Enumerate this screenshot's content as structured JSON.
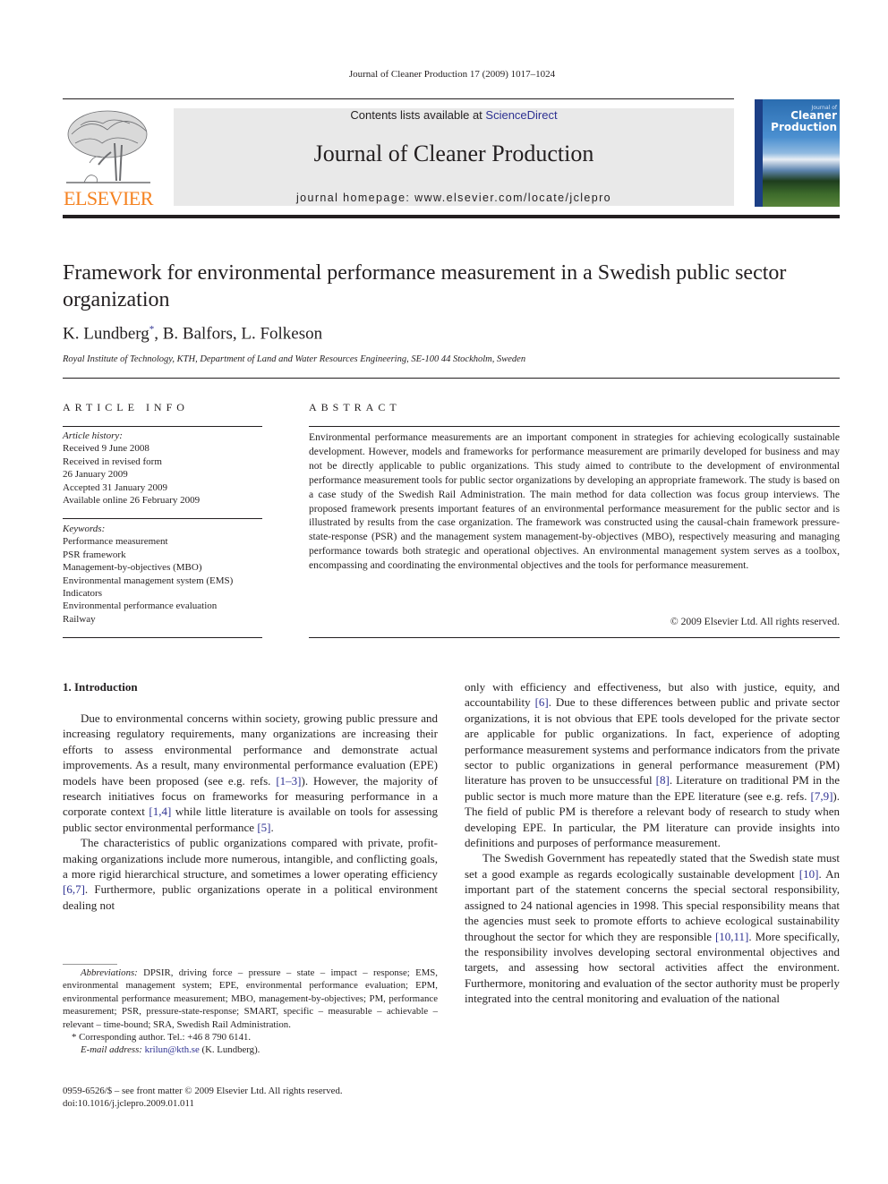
{
  "header": {
    "running_head": "Journal of Cleaner Production 17 (2009) 1017–1024",
    "contents_prefix": "Contents lists available at ",
    "contents_link": "ScienceDirect",
    "journal_title": "Journal of Cleaner Production",
    "homepage": "journal homepage: www.elsevier.com/locate/jclepro",
    "publisher_logo": "ELSEVIER",
    "cover": {
      "line1": "Journal of",
      "line2": "Cleaner",
      "line3": "Production"
    },
    "colors": {
      "publisher_orange": "#f58220",
      "link_blue": "#2e3192",
      "masthead_gray": "#e9e9e9"
    }
  },
  "article": {
    "title": "Framework for environmental performance measurement in a Swedish public sector organization",
    "authors": [
      {
        "name": "K. Lundberg",
        "mark": "*",
        "sep": ", "
      },
      {
        "name": "B. Balfors",
        "mark": "",
        "sep": ", "
      },
      {
        "name": "L. Folkeson",
        "mark": "",
        "sep": ""
      }
    ],
    "affiliation": "Royal Institute of Technology, KTH, Department of Land and Water Resources Engineering, SE-100 44 Stockholm, Sweden"
  },
  "article_info": {
    "heading": "ARTICLE INFO",
    "history_label": "Article history:",
    "history": [
      "Received 9 June 2008",
      "Received in revised form",
      "26 January 2009",
      "Accepted 31 January 2009",
      "Available online 26 February 2009"
    ],
    "keywords_label": "Keywords:",
    "keywords": [
      "Performance measurement",
      "PSR framework",
      "Management-by-objectives (MBO)",
      "Environmental management system (EMS)",
      "Indicators",
      "Environmental performance evaluation",
      "Railway"
    ]
  },
  "abstract": {
    "heading": "ABSTRACT",
    "text": "Environmental performance measurements are an important component in strategies for achieving ecologically sustainable development. However, models and frameworks for performance measurement are primarily developed for business and may not be directly applicable to public organizations. This study aimed to contribute to the development of environmental performance measurement tools for public sector organizations by developing an appropriate framework. The study is based on a case study of the Swedish Rail Administration. The main method for data collection was focus group interviews. The proposed framework presents important features of an environmental performance measurement for the public sector and is illustrated by results from the case organization. The framework was constructed using the causal-chain framework pressure-state-response (PSR) and the management system management-by-objectives (MBO), respectively measuring and managing performance towards both strategic and operational objectives. An environmental management system serves as a toolbox, encompassing and coordinating the environmental objectives and the tools for performance measurement.",
    "copyright": "© 2009 Elsevier Ltd. All rights reserved."
  },
  "introduction": {
    "heading": "1.  Introduction",
    "left_paragraphs": [
      [
        {
          "t": "Due to environmental concerns within society, growing public pressure and increasing regulatory requirements, many organizations are increasing their efforts to assess environmental performance and demonstrate actual improvements. As a result, many environmental performance evaluation (EPE) models have been proposed (see e.g. refs. "
        },
        {
          "t": "[1–3]",
          "cite": true
        },
        {
          "t": "). However, the majority of research initiatives focus on frameworks for measuring performance in a corporate context "
        },
        {
          "t": "[1,4]",
          "cite": true
        },
        {
          "t": " while little literature is available on tools for assessing public sector environmental performance "
        },
        {
          "t": "[5]",
          "cite": true
        },
        {
          "t": "."
        }
      ],
      [
        {
          "t": "The characteristics of public organizations compared with private, profit-making organizations include more numerous, intangible, and conflicting goals, a more rigid hierarchical structure, and sometimes a lower operating efficiency "
        },
        {
          "t": "[6,7]",
          "cite": true
        },
        {
          "t": ". Furthermore, public organizations operate in a political environment dealing not"
        }
      ]
    ],
    "right_paragraphs": [
      [
        {
          "t": "only with efficiency and effectiveness, but also with justice, equity, and accountability "
        },
        {
          "t": "[6]",
          "cite": true
        },
        {
          "t": ". Due to these differences between public and private sector organizations, it is not obvious that EPE tools developed for the private sector are applicable for public organizations. In fact, experience of adopting performance measurement systems and performance indicators from the private sector to public organizations in general performance measurement (PM) literature has proven to be unsuccessful "
        },
        {
          "t": "[8]",
          "cite": true
        },
        {
          "t": ". Literature on traditional PM in the public sector is much more mature than the EPE literature (see e.g. refs. "
        },
        {
          "t": "[7,9]",
          "cite": true
        },
        {
          "t": "). The field of public PM is therefore a relevant body of research to study when developing EPE. In particular, the PM literature can provide insights into definitions and purposes of performance measurement."
        }
      ],
      [
        {
          "t": "The Swedish Government has repeatedly stated that the Swedish state must set a good example as regards ecologically sustainable development "
        },
        {
          "t": "[10]",
          "cite": true
        },
        {
          "t": ". An important part of the statement concerns the special sectoral responsibility, assigned to 24 national agencies in 1998. This special responsibility means that the agencies must seek to promote efforts to achieve ecological sustainability throughout the sector for which they are responsible "
        },
        {
          "t": "[10,11]",
          "cite": true
        },
        {
          "t": ". More specifically, the responsibility involves developing sectoral environmental objectives and targets, and assessing how sectoral activities affect the environment. Furthermore, monitoring and evaluation of the sector authority must be properly integrated into the central monitoring and evaluation of the national"
        }
      ]
    ]
  },
  "footnotes": {
    "abbreviations_label": "Abbreviations:",
    "abbreviations": " DPSIR, driving force – pressure – state – impact – response; EMS, environmental management system; EPE, environmental performance evaluation; EPM, environmental performance measurement; MBO, management-by-objectives; PM, performance measurement; PSR, pressure-state-response; SMART, specific – measurable – achievable – relevant – time-bound; SRA, Swedish Rail Administration.",
    "corresponding_mark": "*",
    "corresponding": " Corresponding author. Tel.: +46 8 790 6141.",
    "email_label": "E-mail address:",
    "email": "krilun@kth.se",
    "email_suffix": " (K. Lundberg)."
  },
  "front_matter": {
    "issn_line": "0959-6526/$ – see front matter © 2009 Elsevier Ltd. All rights reserved.",
    "doi": "doi:10.1016/j.jclepro.2009.01.011"
  }
}
